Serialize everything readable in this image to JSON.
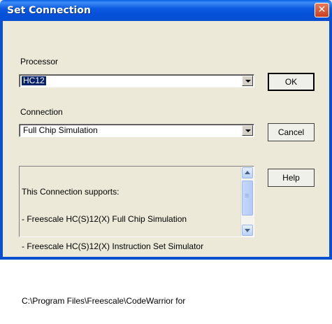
{
  "window": {
    "title": "Set Connection"
  },
  "processor": {
    "label": "Processor",
    "value": "HC12"
  },
  "connection": {
    "label": "Connection",
    "value": "Full Chip Simulation"
  },
  "buttons": {
    "ok": "OK",
    "cancel": "Cancel",
    "help": "Help"
  },
  "info": {
    "lines": [
      "This Connection supports:",
      "- Freescale HC(S)12(X) Full Chip Simulation",
      "- Freescale HC(S)12(X) Instruction Set Simulator",
      "",
      "C:\\Program Files\\Freescale\\CodeWarrior for"
    ]
  },
  "icons": {
    "close": "close-icon",
    "dropdown": "chevron-down-icon",
    "scroll_up": "scroll-up-icon",
    "scroll_down": "scroll-down-icon"
  },
  "colors": {
    "titlebar": "#0A4FD0",
    "dialog_bg": "#ECE9D8",
    "selection": "#0A246A",
    "close_button": "#C7401F"
  }
}
